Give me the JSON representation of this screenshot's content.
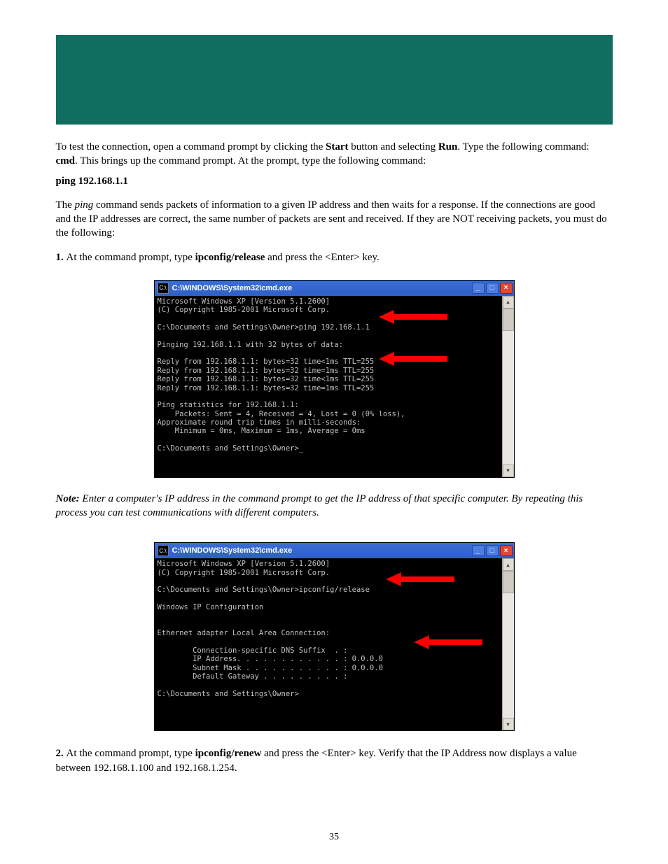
{
  "banner": {},
  "text": {
    "intro1": "To test the connection, open a command prompt by clicking the ",
    "intro_bold": "Start",
    "intro2": " button and selecting ",
    "intro_bold2": "Run",
    "intro3": ". Type the following command: ",
    "intro_bold3": "cmd",
    "intro4": ". This brings up the command prompt. At the prompt, type the following command:\n",
    "ping_cmd": "ping 192.168.1.1",
    "after_ping1": "The ",
    "after_ping_italic": "ping",
    "after_ping2": " command sends packets of information to a given IP address and then waits for a response. If the connections are good and the IP addresses are correct, the same number of packets are sent and received. If they are NOT receiving packets, you must do the following:",
    "step1_bullet": "1. ",
    "step1_pre": "At the command prompt, type ",
    "step1_bold": "ipconfig/release",
    "step1_post": " and press the <Enter> key.",
    "note_bold": "Note:",
    "note_body": " Enter a computer's IP address in the command prompt to get the IP address of that specific computer. By repeating this process you can test communications with different computers.",
    "step2_bullet": "2. ",
    "step2_pre": "At the command prompt, type ",
    "step2_bold": "ipconfig/renew",
    "step2_post": " and press the <Enter> key. Verify that the IP Address now displays a value between 192.168.1.100 and 192.168.1.254."
  },
  "cmd": {
    "title": "C:\\WINDOWS\\System32\\cmd.exe",
    "min": "_",
    "max": "□",
    "close": "×",
    "scroll_up": "▲",
    "scroll_down": "▼",
    "icon_text": "C:\\"
  },
  "cmd1_text": "Microsoft Windows XP [Version 5.1.2600]\n(C) Copyright 1985-2001 Microsoft Corp.\n\nC:\\Documents and Settings\\Owner>ping 192.168.1.1\n\nPinging 192.168.1.1 with 32 bytes of data:\n\nReply from 192.168.1.1: bytes=32 time<1ms TTL=255\nReply from 192.168.1.1: bytes=32 time=1ms TTL=255\nReply from 192.168.1.1: bytes=32 time<1ms TTL=255\nReply from 192.168.1.1: bytes=32 time=1ms TTL=255\n\nPing statistics for 192.168.1.1:\n    Packets: Sent = 4, Received = 4, Lost = 0 (0% loss),\nApproximate round trip times in milli-seconds:\n    Minimum = 0ms, Maximum = 1ms, Average = 0ms\n\nC:\\Documents and Settings\\Owner>_",
  "cmd2_text": "Microsoft Windows XP [Version 5.1.2600]\n(C) Copyright 1985-2001 Microsoft Corp.\n\nC:\\Documents and Settings\\Owner>ipconfig/release\n\nWindows IP Configuration\n\n\nEthernet adapter Local Area Connection:\n\n        Connection-specific DNS Suffix  . :\n        IP Address. . . . . . . . . . . . : 0.0.0.0\n        Subnet Mask . . . . . . . . . . . : 0.0.0.0\n        Default Gateway . . . . . . . . . :\n\nC:\\Documents and Settings\\Owner>",
  "footer": {
    "page": "35"
  }
}
